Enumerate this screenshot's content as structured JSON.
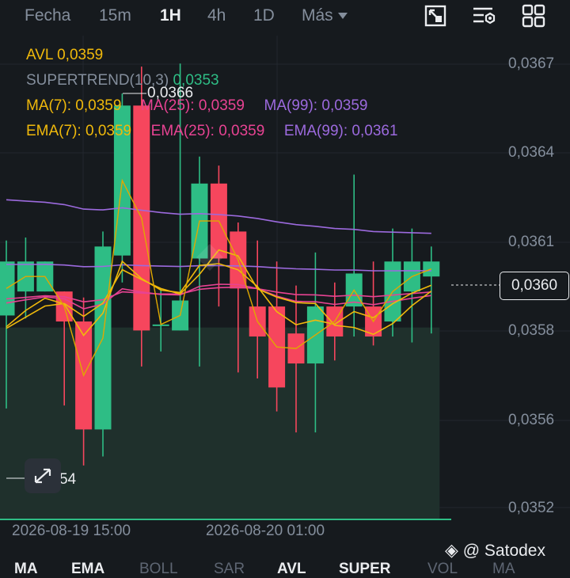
{
  "tabs": [
    {
      "label": "Fecha",
      "active": false
    },
    {
      "label": "15m",
      "active": false
    },
    {
      "label": "1H",
      "active": true
    },
    {
      "label": "4h",
      "active": false
    },
    {
      "label": "1D",
      "active": false
    },
    {
      "label": "Más",
      "active": false
    }
  ],
  "tools": [
    "fullscreen-icon",
    "chart-settings-icon",
    "layout-grid-icon"
  ],
  "indicators": {
    "avl": {
      "label": "AVL",
      "value": "0,0359",
      "color": "#f0b90b"
    },
    "supertrend": {
      "label": "SUPERTREND(10,3)",
      "value": "0,0353",
      "label_color": "#848e9c",
      "value_color": "#2ebd85"
    },
    "ma": [
      {
        "label": "MA(7):",
        "value": "0,0359",
        "color": "#f0b90b"
      },
      {
        "label": "MA(25):",
        "value": "0,0359",
        "color": "#e84393"
      },
      {
        "label": "MA(99):",
        "value": "0,0359",
        "color": "#9c6ade"
      }
    ],
    "ema": [
      {
        "label": "EMA(7):",
        "value": "0,0359",
        "color": "#f0b90b"
      },
      {
        "label": "EMA(25):",
        "value": "0,0359",
        "color": "#e84393"
      },
      {
        "label": "EMA(99):",
        "value": "0,0361",
        "color": "#9c6ade"
      }
    ]
  },
  "y_axis": [
    "0,0367",
    "0,0364",
    "0,0361",
    "0,0358",
    "0,0356",
    "0,0352"
  ],
  "x_axis": [
    "2026-08-19 15:00",
    "2026-08-20 01:00"
  ],
  "current_price": "0,0360",
  "high_marker": "0,0366",
  "low_marker": "0,0354",
  "bottom_tabs": [
    {
      "label": "MA",
      "active": true
    },
    {
      "label": "EMA",
      "active": true
    },
    {
      "label": "BOLL",
      "active": false
    },
    {
      "label": "SAR",
      "active": false
    },
    {
      "label": "AVL",
      "active": true
    },
    {
      "label": "SUPER",
      "active": true
    },
    {
      "label": "VOL",
      "active": false
    },
    {
      "label": "MA",
      "active": false
    }
  ],
  "watermark": "@ Satodex",
  "chart_data": {
    "type": "candlestick",
    "ylim": [
      0.03515,
      0.03675
    ],
    "candles": [
      {
        "o": 0.03583,
        "c": 0.03601,
        "h": 0.03608,
        "l": 0.03552
      },
      {
        "o": 0.03591,
        "c": 0.03601,
        "h": 0.03609,
        "l": 0.03582
      },
      {
        "o": 0.03591,
        "c": 0.03601,
        "h": 0.03601,
        "l": 0.03591
      },
      {
        "o": 0.03591,
        "c": 0.03581,
        "h": 0.03591,
        "l": 0.03553
      },
      {
        "o": 0.03581,
        "c": 0.03545,
        "h": 0.03589,
        "l": 0.03533
      },
      {
        "o": 0.03545,
        "c": 0.03606,
        "h": 0.03611,
        "l": 0.03536
      },
      {
        "o": 0.03603,
        "c": 0.03653,
        "h": 0.03657,
        "l": 0.03594
      },
      {
        "o": 0.03653,
        "c": 0.03578,
        "h": 0.03666,
        "l": 0.03566
      },
      {
        "o": 0.0358,
        "c": 0.0358,
        "h": 0.03592,
        "l": 0.03571
      },
      {
        "o": 0.03578,
        "c": 0.03588,
        "h": 0.03667,
        "l": 0.03578
      },
      {
        "o": 0.03602,
        "c": 0.03627,
        "h": 0.03636,
        "l": 0.03566
      },
      {
        "o": 0.03627,
        "c": 0.03602,
        "h": 0.03633,
        "l": 0.03586
      },
      {
        "o": 0.03611,
        "c": 0.03592,
        "h": 0.03614,
        "l": 0.03564
      },
      {
        "o": 0.03586,
        "c": 0.03576,
        "h": 0.03608,
        "l": 0.03562
      },
      {
        "o": 0.03586,
        "c": 0.03559,
        "h": 0.03601,
        "l": 0.03551
      },
      {
        "o": 0.03577,
        "c": 0.03567,
        "h": 0.03593,
        "l": 0.03544
      },
      {
        "o": 0.03567,
        "c": 0.03586,
        "h": 0.03604,
        "l": 0.03544
      },
      {
        "o": 0.03586,
        "c": 0.03576,
        "h": 0.03594,
        "l": 0.03568
      },
      {
        "o": 0.03586,
        "c": 0.03597,
        "h": 0.0363,
        "l": 0.03576
      },
      {
        "o": 0.03586,
        "c": 0.03576,
        "h": 0.03601,
        "l": 0.03573
      },
      {
        "o": 0.03581,
        "c": 0.03601,
        "h": 0.03612,
        "l": 0.03576
      },
      {
        "o": 0.03591,
        "c": 0.03601,
        "h": 0.03612,
        "l": 0.03574
      },
      {
        "o": 0.03596,
        "c": 0.03601,
        "h": 0.03606,
        "l": 0.03577
      }
    ]
  }
}
